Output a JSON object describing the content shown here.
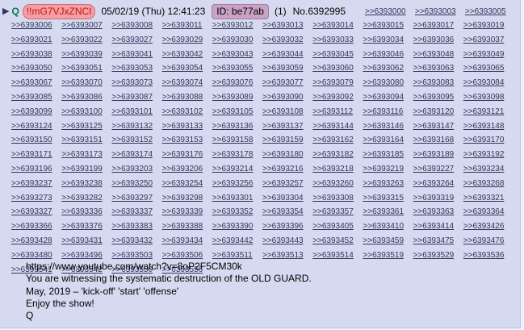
{
  "post": {
    "arrow": "▶",
    "name": "Q",
    "tripcode": "!!mG7VJxZNCI",
    "date": "05/02/19 (Thu) 12:41:23",
    "id_label": "ID: be77ab",
    "count": "(1)",
    "number": "No.6392995",
    "header_backlinks": [
      ">>6393000",
      ">>6393003",
      ">>6393005"
    ],
    "backlink_rows": [
      [
        ">>6393006",
        ">>6393007",
        ">>6393008",
        ">>6393011",
        ">>6393012",
        ">>6393013",
        ">>6393014",
        ">>6393015",
        ">>6393017",
        ">>6393019"
      ],
      [
        ">>6393021",
        ">>6393022",
        ">>6393027",
        ">>6393029",
        ">>6393030",
        ">>6393032",
        ">>6393033",
        ">>6393034",
        ">>6393036",
        ">>6393037"
      ],
      [
        ">>6393038",
        ">>6393039",
        ">>6393041",
        ">>6393042",
        ">>6393043",
        ">>6393044",
        ">>6393045",
        ">>6393046",
        ">>6393048",
        ">>6393049"
      ],
      [
        ">>6393050",
        ">>6393051",
        ">>6393053",
        ">>6393054",
        ">>6393055",
        ">>6393059",
        ">>6393060",
        ">>6393062",
        ">>6393063",
        ">>6393065"
      ],
      [
        ">>6393067",
        ">>6393070",
        ">>6393073",
        ">>6393074",
        ">>6393076",
        ">>6393077",
        ">>6393079",
        ">>6393080",
        ">>6393083",
        ">>6393084"
      ],
      [
        ">>6393085",
        ">>6393086",
        ">>6393087",
        ">>6393088",
        ">>6393089",
        ">>6393090",
        ">>6393092",
        ">>6393094",
        ">>6393095",
        ">>6393098"
      ],
      [
        ">>6393099",
        ">>6393100",
        ">>6393101",
        ">>6393102",
        ">>6393105",
        ">>6393108",
        ">>6393112",
        ">>6393116",
        ">>6393120",
        ">>6393121"
      ],
      [
        ">>6393124",
        ">>6393125",
        ">>6393132",
        ">>6393133",
        ">>6393136",
        ">>6393137",
        ">>6393144",
        ">>6393146",
        ">>6393147",
        ">>6393148"
      ],
      [
        ">>6393150",
        ">>6393151",
        ">>6393152",
        ">>6393153",
        ">>6393158",
        ">>6393159",
        ">>6393162",
        ">>6393164",
        ">>6393168",
        ">>6393170"
      ],
      [
        ">>6393171",
        ">>6393173",
        ">>6393174",
        ">>6393176",
        ">>6393178",
        ">>6393180",
        ">>6393182",
        ">>6393185",
        ">>6393189",
        ">>6393192"
      ],
      [
        ">>6393196",
        ">>6393199",
        ">>6393203",
        ">>6393206",
        ">>6393214",
        ">>6393216",
        ">>6393218",
        ">>6393219",
        ">>6393227",
        ">>6393234"
      ],
      [
        ">>6393237",
        ">>6393238",
        ">>6393250",
        ">>6393254",
        ">>6393256",
        ">>6393257",
        ">>6393260",
        ">>6393263",
        ">>6393264",
        ">>6393268"
      ],
      [
        ">>6393273",
        ">>6393282",
        ">>6393297",
        ">>6393298",
        ">>6393301",
        ">>6393304",
        ">>6393308",
        ">>6393315",
        ">>6393319",
        ">>6393321"
      ],
      [
        ">>6393327",
        ">>6393336",
        ">>6393337",
        ">>6393339",
        ">>6393352",
        ">>6393354",
        ">>6393357",
        ">>6393361",
        ">>6393363",
        ">>6393364"
      ],
      [
        ">>6393366",
        ">>6393376",
        ">>6393383",
        ">>6393388",
        ">>6393390",
        ">>6393396",
        ">>6393405",
        ">>6393410",
        ">>6393414",
        ">>6393426"
      ],
      [
        ">>6393428",
        ">>6393431",
        ">>6393432",
        ">>6393434",
        ">>6393442",
        ">>6393443",
        ">>6393452",
        ">>6393459",
        ">>6393475",
        ">>6393476"
      ],
      [
        ">>6393480",
        ">>6393496",
        ">>6393503",
        ">>6393506",
        ">>6393511",
        ">>6393513",
        ">>6393514",
        ">>6393519",
        ">>6393529",
        ">>6393536"
      ],
      [
        ">>6393541",
        ">>6393542",
        ">>6393550",
        ">>6393556"
      ]
    ],
    "body_lines": [
      "https://www.youtube.com/watch?v=8oP2F5CM30k",
      "You are witnessing the systematic destruction of the OLD GUARD.",
      "May, 2019 – 'kick-off' 'start' 'offense'",
      "Enjoy the show!",
      "Q"
    ]
  },
  "colors": {
    "background": "#d6daf0",
    "name": "#117743",
    "tripcode": "#cc1105",
    "backlink": "#34345c"
  }
}
